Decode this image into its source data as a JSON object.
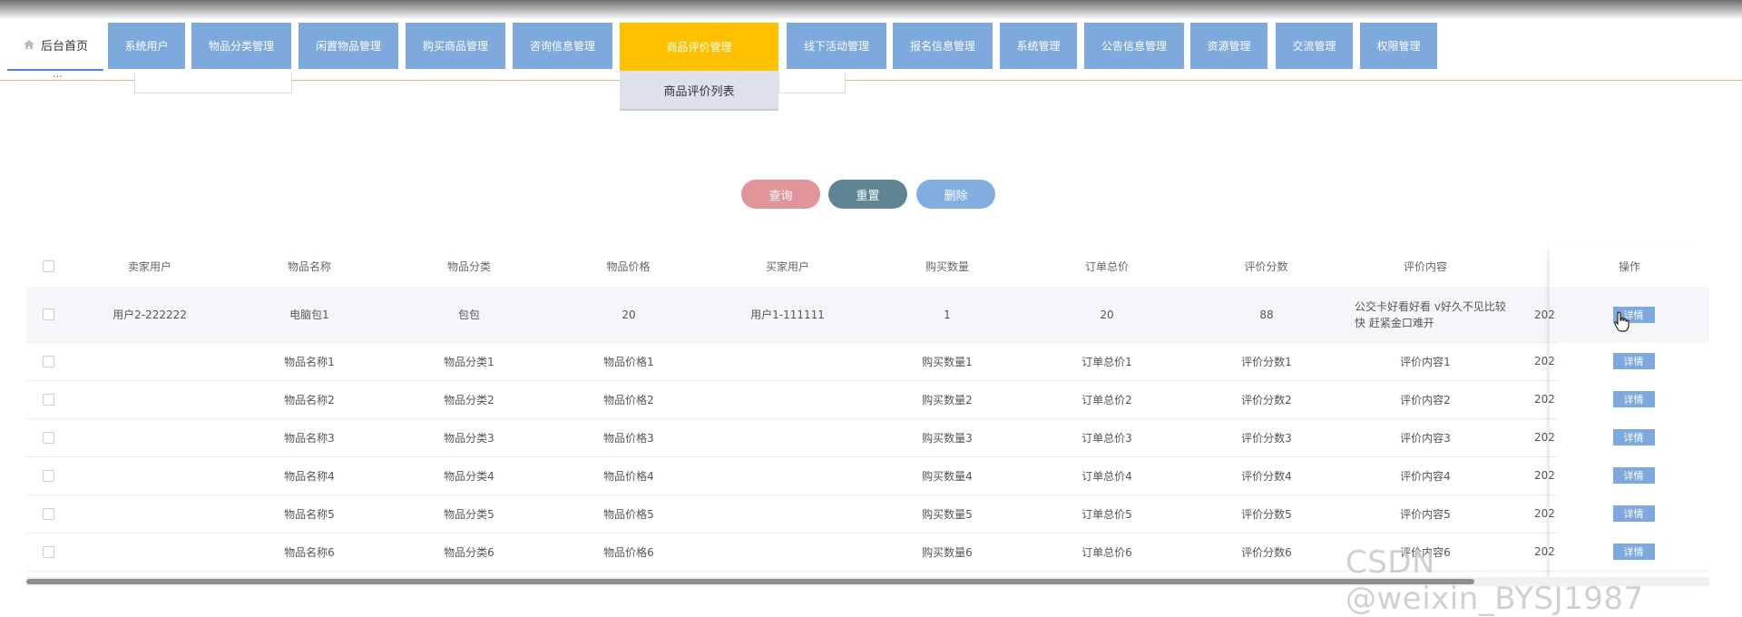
{
  "nav": {
    "home": "后台首页",
    "items": [
      {
        "label": "系统用户"
      },
      {
        "label": "物品分类管理"
      },
      {
        "label": "闲置物品管理"
      },
      {
        "label": "购买商品管理"
      },
      {
        "label": "咨询信息管理"
      },
      {
        "label": "商品评价管理",
        "active": true
      },
      {
        "label": "线下活动管理"
      },
      {
        "label": "报名信息管理"
      },
      {
        "label": "系统管理"
      },
      {
        "label": "公告信息管理"
      },
      {
        "label": "资源管理"
      },
      {
        "label": "交流管理"
      },
      {
        "label": "权限管理"
      }
    ],
    "dropdown_item": "商品评价列表"
  },
  "actions": {
    "query": "查询",
    "reset": "重置",
    "delete": "删除"
  },
  "colors": {
    "accent": "#7ea9dc",
    "active": "#ffc000",
    "query": "#e0959b",
    "reset": "#5f8592",
    "delete": "#82aee0"
  },
  "table": {
    "columns": [
      "卖家用户",
      "物品名称",
      "物品分类",
      "物品价格",
      "买家用户",
      "购买数量",
      "订单总价",
      "评价分数",
      "评价内容",
      "操作"
    ],
    "rows": [
      {
        "seller": "用户2-222222",
        "name": "电脑包1",
        "category": "包包",
        "price": "20",
        "buyer": "用户1-111111",
        "qty": "1",
        "total": "20",
        "score": "88",
        "content": "公交卡好看好看 v好久不见比较快 赶紧金口难开",
        "date": "202"
      },
      {
        "seller": "",
        "name": "物品名称1",
        "category": "物品分类1",
        "price": "物品价格1",
        "buyer": "",
        "qty": "购买数量1",
        "total": "订单总价1",
        "score": "评价分数1",
        "content": "评价内容1",
        "date": "202"
      },
      {
        "seller": "",
        "name": "物品名称2",
        "category": "物品分类2",
        "price": "物品价格2",
        "buyer": "",
        "qty": "购买数量2",
        "total": "订单总价2",
        "score": "评价分数2",
        "content": "评价内容2",
        "date": "202"
      },
      {
        "seller": "",
        "name": "物品名称3",
        "category": "物品分类3",
        "price": "物品价格3",
        "buyer": "",
        "qty": "购买数量3",
        "total": "订单总价3",
        "score": "评价分数3",
        "content": "评价内容3",
        "date": "202"
      },
      {
        "seller": "",
        "name": "物品名称4",
        "category": "物品分类4",
        "price": "物品价格4",
        "buyer": "",
        "qty": "购买数量4",
        "total": "订单总价4",
        "score": "评价分数4",
        "content": "评价内容4",
        "date": "202"
      },
      {
        "seller": "",
        "name": "物品名称5",
        "category": "物品分类5",
        "price": "物品价格5",
        "buyer": "",
        "qty": "购买数量5",
        "total": "订单总价5",
        "score": "评价分数5",
        "content": "评价内容5",
        "date": "202"
      },
      {
        "seller": "",
        "name": "物品名称6",
        "category": "物品分类6",
        "price": "物品价格6",
        "buyer": "",
        "qty": "购买数量6",
        "total": "订单总价6",
        "score": "评价分数6",
        "content": "评价内容6",
        "date": "202"
      }
    ],
    "detail_label": "详情"
  },
  "watermark": "CSDN @weixin_BYSJ1987"
}
